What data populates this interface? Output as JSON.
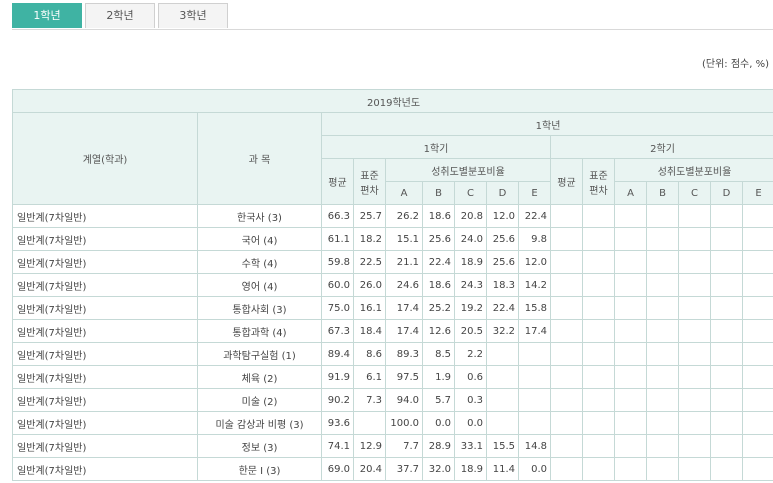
{
  "tabs": [
    {
      "label": "1학년",
      "active": true
    },
    {
      "label": "2학년",
      "active": false
    },
    {
      "label": "3학년",
      "active": false
    }
  ],
  "unit_note": "(단위: 점수, %)",
  "table": {
    "year_header": "2019학년도",
    "col_dept": "계열(학과)",
    "col_subject": "과 목",
    "grade_header": "1학년",
    "sem1": "1학기",
    "sem2": "2학기",
    "avg": "평균",
    "std_line1": "표준",
    "std_line2": "편차",
    "dist": "성취도별분포비율",
    "grades": [
      "A",
      "B",
      "C",
      "D",
      "E"
    ],
    "rows": [
      {
        "dept": "일반계(7차일반)",
        "subject": "한국사 (3)",
        "avg": "66.3",
        "std": "25.7",
        "a": "26.2",
        "b": "18.6",
        "c": "20.8",
        "d": "12.0",
        "e": "22.4"
      },
      {
        "dept": "일반계(7차일반)",
        "subject": "국어 (4)",
        "avg": "61.1",
        "std": "18.2",
        "a": "15.1",
        "b": "25.6",
        "c": "24.0",
        "d": "25.6",
        "e": "9.8"
      },
      {
        "dept": "일반계(7차일반)",
        "subject": "수학 (4)",
        "avg": "59.8",
        "std": "22.5",
        "a": "21.1",
        "b": "22.4",
        "c": "18.9",
        "d": "25.6",
        "e": "12.0"
      },
      {
        "dept": "일반계(7차일반)",
        "subject": "영어 (4)",
        "avg": "60.0",
        "std": "26.0",
        "a": "24.6",
        "b": "18.6",
        "c": "24.3",
        "d": "18.3",
        "e": "14.2"
      },
      {
        "dept": "일반계(7차일반)",
        "subject": "통합사회 (3)",
        "avg": "75.0",
        "std": "16.1",
        "a": "17.4",
        "b": "25.2",
        "c": "19.2",
        "d": "22.4",
        "e": "15.8"
      },
      {
        "dept": "일반계(7차일반)",
        "subject": "통합과학 (4)",
        "avg": "67.3",
        "std": "18.4",
        "a": "17.4",
        "b": "12.6",
        "c": "20.5",
        "d": "32.2",
        "e": "17.4"
      },
      {
        "dept": "일반계(7차일반)",
        "subject": "과학탐구실험 (1)",
        "avg": "89.4",
        "std": "8.6",
        "a": "89.3",
        "b": "8.5",
        "c": "2.2",
        "d": "",
        "e": ""
      },
      {
        "dept": "일반계(7차일반)",
        "subject": "체육 (2)",
        "avg": "91.9",
        "std": "6.1",
        "a": "97.5",
        "b": "1.9",
        "c": "0.6",
        "d": "",
        "e": ""
      },
      {
        "dept": "일반계(7차일반)",
        "subject": "미술 (2)",
        "avg": "90.2",
        "std": "7.3",
        "a": "94.0",
        "b": "5.7",
        "c": "0.3",
        "d": "",
        "e": ""
      },
      {
        "dept": "일반계(7차일반)",
        "subject": "미술 감상과 비평 (3)",
        "avg": "93.6",
        "std": "",
        "a": "100.0",
        "b": "0.0",
        "c": "0.0",
        "d": "",
        "e": ""
      },
      {
        "dept": "일반계(7차일반)",
        "subject": "정보 (3)",
        "avg": "74.1",
        "std": "12.9",
        "a": "7.7",
        "b": "28.9",
        "c": "33.1",
        "d": "15.5",
        "e": "14.8"
      },
      {
        "dept": "일반계(7차일반)",
        "subject": "한문 I (3)",
        "avg": "69.0",
        "std": "20.4",
        "a": "37.7",
        "b": "32.0",
        "c": "18.9",
        "d": "11.4",
        "e": "0.0"
      }
    ]
  }
}
